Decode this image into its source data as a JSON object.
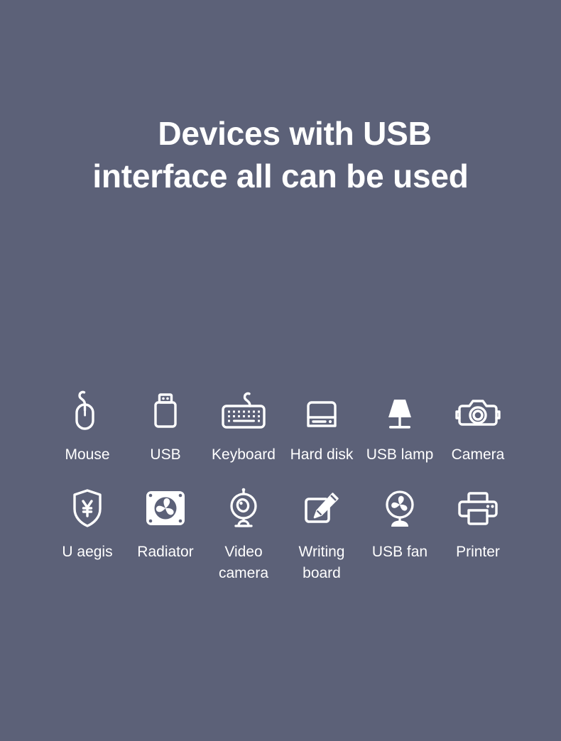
{
  "page": {
    "background_color": "#5c6178",
    "foreground_color": "#ffffff"
  },
  "headline": {
    "line1": "Devices with USB",
    "line2": "interface all can be used"
  },
  "grid": {
    "rows": [
      {
        "items": [
          {
            "icon": "mouse-icon",
            "label": "Mouse"
          },
          {
            "icon": "usb-flash-drive-icon",
            "label": "USB"
          },
          {
            "icon": "keyboard-icon",
            "label": "Keyboard"
          },
          {
            "icon": "hard-disk-icon",
            "label": "Hard disk"
          },
          {
            "icon": "desk-lamp-icon",
            "label": "USB lamp"
          },
          {
            "icon": "camera-icon",
            "label": "Camera"
          }
        ]
      },
      {
        "items": [
          {
            "icon": "shield-yen-icon",
            "label": "U aegis"
          },
          {
            "icon": "radiator-fan-icon",
            "label": "Radiator"
          },
          {
            "icon": "webcam-icon",
            "label": "Video camera"
          },
          {
            "icon": "writing-tablet-pencil-icon",
            "label": "Writing board"
          },
          {
            "icon": "usb-fan-icon",
            "label": "USB fan"
          },
          {
            "icon": "printer-icon",
            "label": "Printer"
          }
        ]
      }
    ]
  }
}
